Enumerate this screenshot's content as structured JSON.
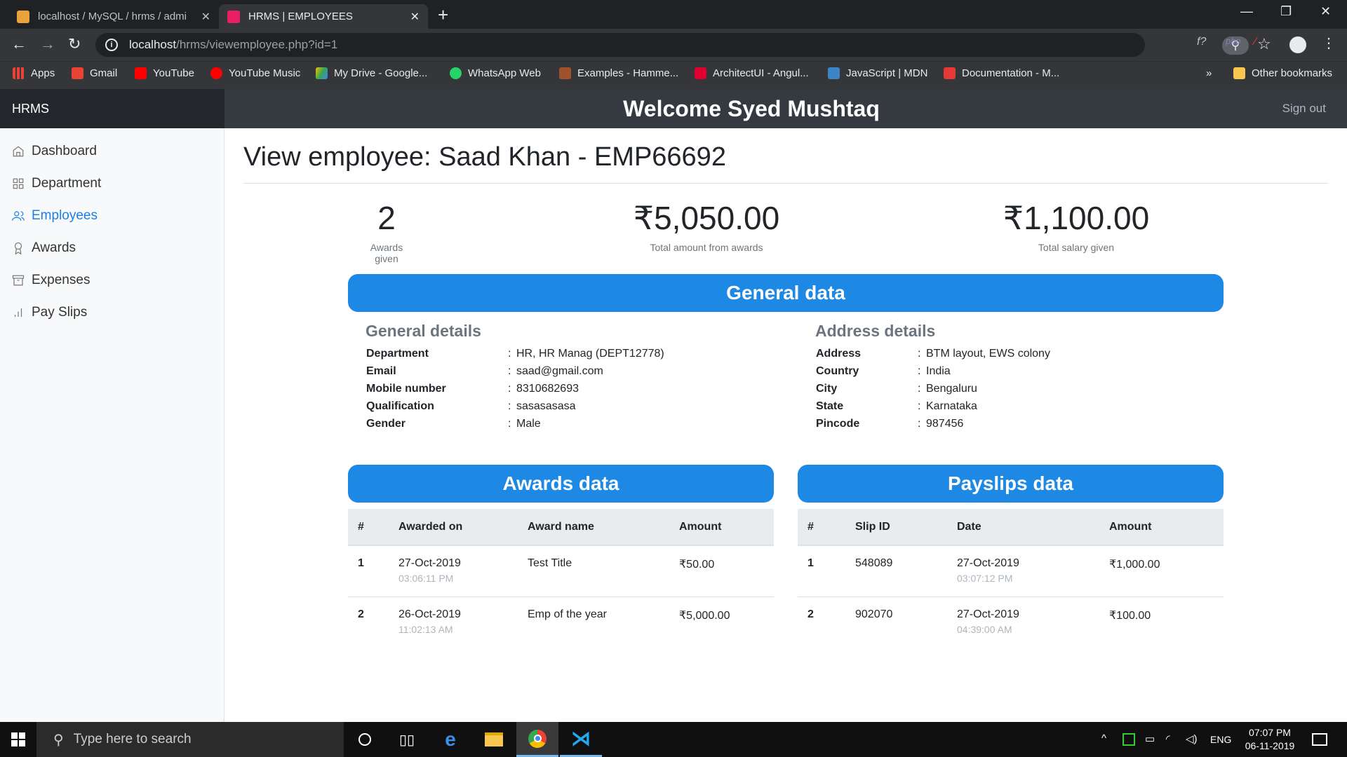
{
  "browser": {
    "tabs": [
      {
        "title": "localhost / MySQL / hrms / admi",
        "favicon_color": "#e8a33d"
      },
      {
        "title": "HRMS | EMPLOYEES",
        "favicon_color": "#e91e63"
      }
    ],
    "url_host": "localhost",
    "url_path": "/hrms/viewemployee.php?id=1",
    "bookmarks": [
      {
        "label": "Apps",
        "color": "#ea4335"
      },
      {
        "label": "Gmail",
        "color": "#ea4335"
      },
      {
        "label": "YouTube",
        "color": "#ff0000"
      },
      {
        "label": "YouTube Music",
        "color": "#ff0000"
      },
      {
        "label": "My Drive - Google...",
        "color": "#34a853"
      },
      {
        "label": "WhatsApp Web",
        "color": "#25d366"
      },
      {
        "label": "Examples - Hamme...",
        "color": "#a0522d"
      },
      {
        "label": "ArchitectUI - Angul...",
        "color": "#dd0031"
      },
      {
        "label": "JavaScript | MDN",
        "color": "#3d85c6"
      },
      {
        "label": "Documentation - M...",
        "color": "#e53935"
      }
    ],
    "more_bookmarks": "»",
    "other_bookmarks": "Other bookmarks"
  },
  "app": {
    "brand": "HRMS",
    "welcome": "Welcome Syed Mushtaq",
    "signout": "Sign out"
  },
  "sidebar": {
    "items": [
      {
        "label": "Dashboard",
        "icon": "home-icon"
      },
      {
        "label": "Department",
        "icon": "grid-icon"
      },
      {
        "label": "Employees",
        "icon": "users-icon",
        "active": true
      },
      {
        "label": "Awards",
        "icon": "award-icon"
      },
      {
        "label": "Expenses",
        "icon": "archive-icon"
      },
      {
        "label": "Pay Slips",
        "icon": "bar-chart-icon"
      }
    ]
  },
  "page": {
    "title": "View employee: Saad Khan - EMP66692",
    "stats": [
      {
        "value": "2",
        "label": "Awards given"
      },
      {
        "value": "₹5,050.00",
        "label": "Total amount from awards"
      },
      {
        "value": "₹1,100.00",
        "label": "Total salary given"
      }
    ],
    "general_banner": "General data",
    "general_details_title": "General details",
    "general_details": [
      {
        "key": "Department",
        "value": "HR, HR Manag (DEPT12778)"
      },
      {
        "key": "Email",
        "value": "saad@gmail.com"
      },
      {
        "key": "Mobile number",
        "value": "8310682693"
      },
      {
        "key": "Qualification",
        "value": "sasasasasa"
      },
      {
        "key": "Gender",
        "value": "Male"
      }
    ],
    "address_details_title": "Address details",
    "address_details": [
      {
        "key": "Address",
        "value": "BTM layout, EWS colony"
      },
      {
        "key": "Country",
        "value": "India"
      },
      {
        "key": "City",
        "value": "Bengaluru"
      },
      {
        "key": "State",
        "value": "Karnataka"
      },
      {
        "key": "Pincode",
        "value": "987456"
      }
    ],
    "separator": ":",
    "awards_banner": "Awards data",
    "awards_headers": [
      "#",
      "Awarded on",
      "Award name",
      "Amount"
    ],
    "awards_rows": [
      {
        "num": "1",
        "date": "27-Oct-2019",
        "time": "03:06:11 PM",
        "name": "Test Title",
        "amount": "₹50.00"
      },
      {
        "num": "2",
        "date": "26-Oct-2019",
        "time": "11:02:13 AM",
        "name": "Emp of the year",
        "amount": "₹5,000.00"
      }
    ],
    "payslips_banner": "Payslips data",
    "payslips_headers": [
      "#",
      "Slip ID",
      "Date",
      "Amount"
    ],
    "payslips_rows": [
      {
        "num": "1",
        "slip": "548089",
        "date": "27-Oct-2019",
        "time": "03:07:12 PM",
        "amount": "₹1,000.00"
      },
      {
        "num": "2",
        "slip": "902070",
        "date": "27-Oct-2019",
        "time": "04:39:00 AM",
        "amount": "₹100.00"
      }
    ]
  },
  "taskbar": {
    "search_placeholder": "Type here to search",
    "lang": "ENG",
    "time": "07:07 PM",
    "date": "06-11-2019"
  }
}
